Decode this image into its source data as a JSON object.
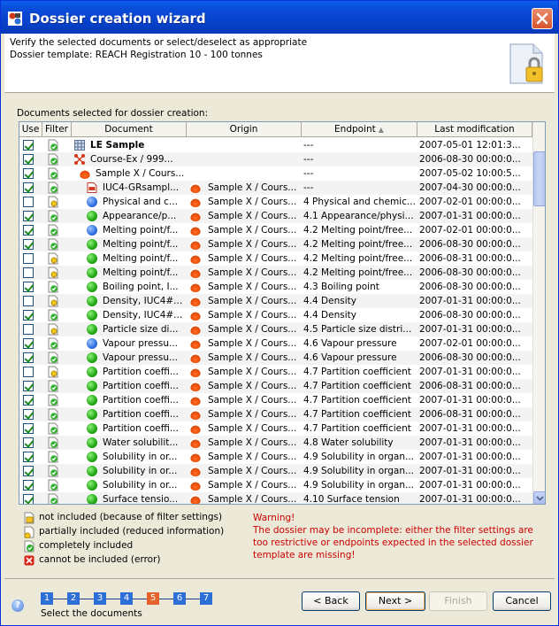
{
  "window": {
    "title": "Dossier creation wizard"
  },
  "header": {
    "line1": "Verify the selected documents or select/deselect as appropriate",
    "line2": "Dossier template: REACH Registration 10 - 100 tonnes"
  },
  "section_label": "Documents selected for dossier creation:",
  "table": {
    "columns": [
      "Use",
      "Filter",
      "Document",
      "Origin",
      "Endpoint",
      "Last modification"
    ],
    "rows": [
      {
        "use": true,
        "filter": "included",
        "icon": "grid",
        "document": "LE Sample",
        "bold": true,
        "origin": "",
        "endpoint": "---",
        "date": "2007-05-01 12:01:3..."
      },
      {
        "use": true,
        "filter": "included",
        "icon": "molecule",
        "document": "Course-Ex / 999...",
        "origin": "",
        "endpoint": "---",
        "date": "2006-08-30 00:00:0..."
      },
      {
        "use": true,
        "filter": "included",
        "icon": "flask",
        "document": "Sample X / Cours...",
        "origin": "",
        "endpoint": "---",
        "date": "2007-05-02 10:00:5..."
      },
      {
        "use": true,
        "filter": "included",
        "icon": "pdf",
        "document": "IUC4-GRsampl...",
        "origin": "Sample X / Cours...",
        "endpoint": "---",
        "date": "2007-04-30 00:00:0..."
      },
      {
        "use": false,
        "filter": "partial",
        "icon": "blue",
        "document": "Physical and c...",
        "origin": "Sample X / Cours...",
        "endpoint": "4 Physical and chemic...",
        "date": "2007-02-01 00:00:0..."
      },
      {
        "use": true,
        "filter": "included",
        "icon": "green",
        "document": "Appearance/p...",
        "origin": "Sample X / Cours...",
        "endpoint": "4.1 Appearance/physi...",
        "date": "2007-01-31 00:00:0..."
      },
      {
        "use": true,
        "filter": "included",
        "icon": "blue",
        "document": "Melting point/f...",
        "origin": "Sample X / Cours...",
        "endpoint": "4.2 Melting point/free...",
        "date": "2007-02-01 00:00:0..."
      },
      {
        "use": true,
        "filter": "included",
        "icon": "green",
        "document": "Melting point/f...",
        "origin": "Sample X / Cours...",
        "endpoint": "4.2 Melting point/free...",
        "date": "2006-08-30 00:00:0..."
      },
      {
        "use": false,
        "filter": "partial",
        "icon": "green",
        "document": "Melting point/f...",
        "origin": "Sample X / Cours...",
        "endpoint": "4.2 Melting point/free...",
        "date": "2006-08-31 00:00:0..."
      },
      {
        "use": false,
        "filter": "partial",
        "icon": "green",
        "document": "Melting point/f...",
        "origin": "Sample X / Cours...",
        "endpoint": "4.2 Melting point/free...",
        "date": "2006-08-30 00:00:0..."
      },
      {
        "use": true,
        "filter": "included",
        "icon": "green",
        "document": "Boiling point, I...",
        "origin": "Sample X / Cours...",
        "endpoint": "4.3 Boiling point",
        "date": "2006-08-30 00:00:0..."
      },
      {
        "use": false,
        "filter": "partial",
        "icon": "green",
        "document": "Density, IUC4#...",
        "origin": "Sample X / Cours...",
        "endpoint": "4.4 Density",
        "date": "2007-01-31 00:00:0..."
      },
      {
        "use": true,
        "filter": "included",
        "icon": "green",
        "document": "Density, IUC4#...",
        "origin": "Sample X / Cours...",
        "endpoint": "4.4 Density",
        "date": "2006-08-30 00:00:0..."
      },
      {
        "use": false,
        "filter": "partial",
        "icon": "green",
        "document": "Particle size di...",
        "origin": "Sample X / Cours...",
        "endpoint": "4.5 Particle size distri...",
        "date": "2007-01-31 00:00:0..."
      },
      {
        "use": true,
        "filter": "included",
        "icon": "blue",
        "document": "Vapour pressu...",
        "origin": "Sample X / Cours...",
        "endpoint": "4.6 Vapour pressure",
        "date": "2007-02-01 00:00:0..."
      },
      {
        "use": true,
        "filter": "included",
        "icon": "green",
        "document": "Vapour pressu...",
        "origin": "Sample X / Cours...",
        "endpoint": "4.6 Vapour pressure",
        "date": "2006-08-30 00:00:0..."
      },
      {
        "use": false,
        "filter": "partial",
        "icon": "green",
        "document": "Partition coeffi...",
        "origin": "Sample X / Cours...",
        "endpoint": "4.7 Partition coefficient",
        "date": "2007-01-31 00:00:0..."
      },
      {
        "use": true,
        "filter": "included",
        "icon": "green",
        "document": "Partition coeffi...",
        "origin": "Sample X / Cours...",
        "endpoint": "4.7 Partition coefficient",
        "date": "2006-08-31 00:00:0..."
      },
      {
        "use": true,
        "filter": "included",
        "icon": "green",
        "document": "Partition coeffi...",
        "origin": "Sample X / Cours...",
        "endpoint": "4.7 Partition coefficient",
        "date": "2007-01-31 00:00:0..."
      },
      {
        "use": true,
        "filter": "included",
        "icon": "green",
        "document": "Partition coeffi...",
        "origin": "Sample X / Cours...",
        "endpoint": "4.7 Partition coefficient",
        "date": "2006-08-31 00:00:0..."
      },
      {
        "use": true,
        "filter": "included",
        "icon": "green",
        "document": "Partition coeffi...",
        "origin": "Sample X / Cours...",
        "endpoint": "4.7 Partition coefficient",
        "date": "2007-01-31 00:00:0..."
      },
      {
        "use": true,
        "filter": "included",
        "icon": "green",
        "document": "Water solubilit...",
        "origin": "Sample X / Cours...",
        "endpoint": "4.8 Water solubility",
        "date": "2007-01-31 00:00:0..."
      },
      {
        "use": true,
        "filter": "included",
        "icon": "green",
        "document": "Solubility in or...",
        "origin": "Sample X / Cours...",
        "endpoint": "4.9 Solubility in organ...",
        "date": "2007-01-31 00:00:0..."
      },
      {
        "use": true,
        "filter": "included",
        "icon": "green",
        "document": "Solubility in or...",
        "origin": "Sample X / Cours...",
        "endpoint": "4.9 Solubility in organ...",
        "date": "2007-01-31 00:00:0..."
      },
      {
        "use": true,
        "filter": "included",
        "icon": "green",
        "document": "Solubility in or...",
        "origin": "Sample X / Cours...",
        "endpoint": "4.9 Solubility in organ...",
        "date": "2007-01-31 00:00:0..."
      },
      {
        "use": true,
        "filter": "included",
        "icon": "green",
        "document": "Surface tensio...",
        "origin": "Sample X / Cours...",
        "endpoint": "4.10 Surface tension",
        "date": "2007-01-31 00:00:0..."
      }
    ]
  },
  "legend": [
    {
      "key": "not",
      "label": "not included (because of filter settings)"
    },
    {
      "key": "partial",
      "label": "partially included (reduced information)"
    },
    {
      "key": "complete",
      "label": "completely included"
    },
    {
      "key": "error",
      "label": "cannot be included (error)"
    }
  ],
  "warning": {
    "title": "Warning!",
    "text": "The dossier may be incomplete: either the filter settings are too restrictive or endpoints expected in the selected dossier template are missing!"
  },
  "steps": {
    "numbers": [
      "1",
      "2",
      "3",
      "4",
      "5",
      "6",
      "7"
    ],
    "active_index": 4,
    "caption": "Select the documents"
  },
  "buttons": {
    "back": "< Back",
    "next": "Next >",
    "finish": "Finish",
    "cancel": "Cancel"
  },
  "colors": {
    "title_bar": "#0a4ad8",
    "warning": "#cc0000",
    "step": "#2d6fd6",
    "step_active": "#e5622b"
  }
}
